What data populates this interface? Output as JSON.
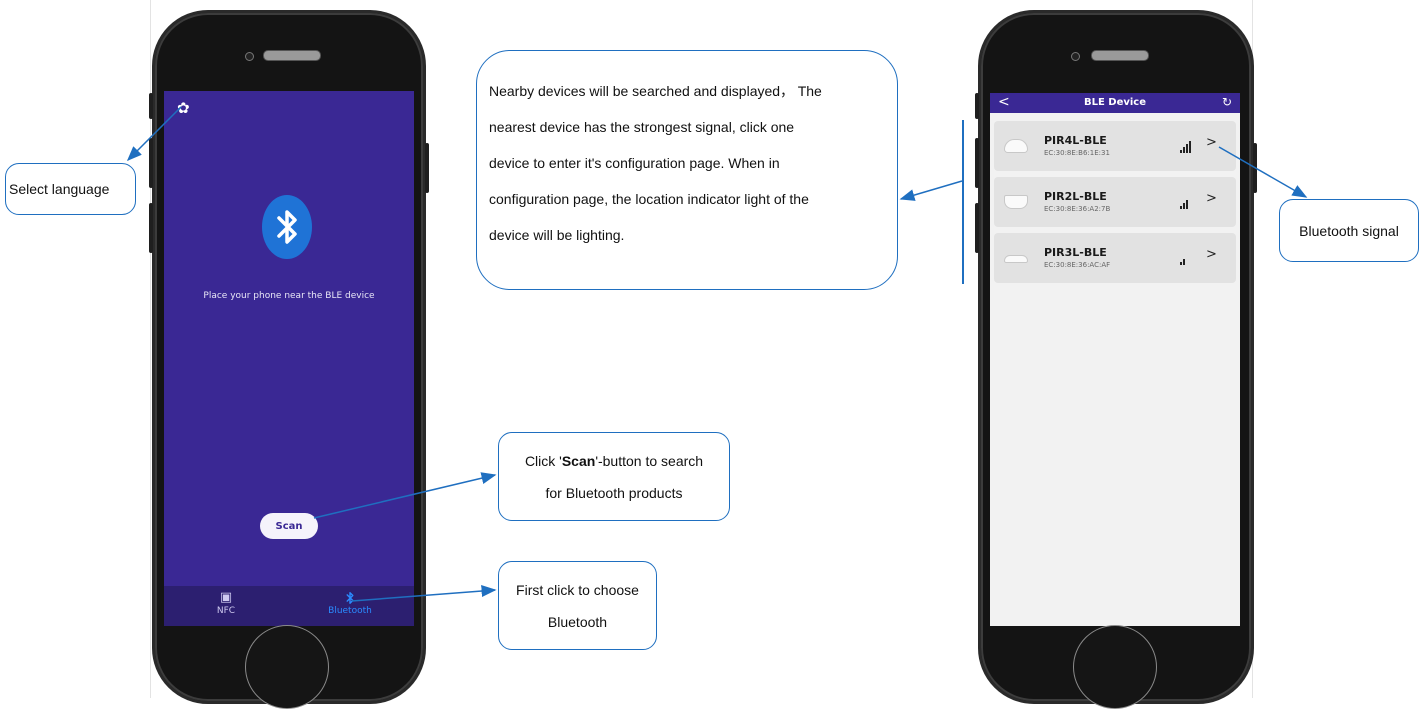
{
  "left_phone": {
    "settings_icon": "gear-icon",
    "bluetooth_icon": "bluetooth-icon",
    "instruction": "Place your phone near the BLE device",
    "scan_label": "Scan",
    "tabs": [
      {
        "label": "NFC",
        "icon": "nfc-icon",
        "color": "#cfcaf0"
      },
      {
        "label": "Bluetooth",
        "icon": "bluetooth-icon",
        "color": "#2a8bff",
        "active": true
      }
    ]
  },
  "right_phone": {
    "title": "BLE Device",
    "back_icon": "chevron-left-icon",
    "refresh_icon": "refresh-icon",
    "devices": [
      {
        "name": "PIR4L-BLE",
        "mac": "EC:30:8E:B6:1E:31",
        "signal_bars": 4
      },
      {
        "name": "PIR2L-BLE",
        "mac": "EC:30:8E:36:A2:7B",
        "signal_bars": 3
      },
      {
        "name": "PIR3L-BLE",
        "mac": "EC:30:8E:36:AC:AF",
        "signal_bars": 2
      }
    ]
  },
  "callouts": {
    "language": "Select language",
    "nearby": [
      "Nearby devices will be searched and displayed， The",
      "nearest device has the strongest signal, click one",
      "device to enter it's configuration page. When in",
      "configuration page, the location indicator light of the",
      "device will be lighting."
    ],
    "scan_prefix": "Click '",
    "scan_bold": "Scan",
    "scan_suffix": "'-button to search",
    "scan_line2": "for Bluetooth products",
    "bt_line1": "First click to choose",
    "bt_line2": "Bluetooth",
    "signal": "Bluetooth signal"
  },
  "colors": {
    "accent": "#3a2894",
    "callout_border": "#1f6fc0",
    "bluetooth": "#1f73d6"
  }
}
